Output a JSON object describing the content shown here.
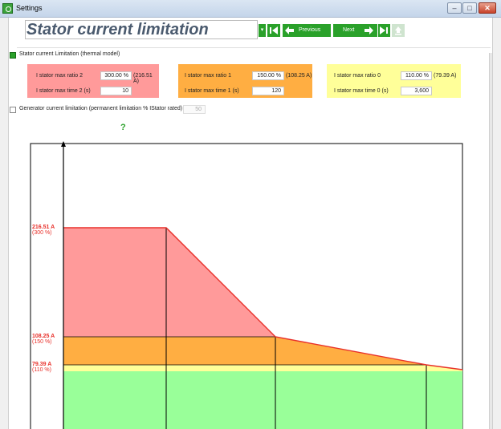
{
  "window": {
    "title": "Settings"
  },
  "header": {
    "page_title": "Stator current limitation",
    "previous_label": "Previous",
    "next_label": "Next"
  },
  "thermal": {
    "checkbox_label": "Stator current Limitation (thermal model)",
    "checked": true,
    "levels": [
      {
        "ratio_label": "I stator max ratio 2",
        "ratio_value": "300.00 %",
        "amps": "(216.51 A)",
        "time_label": "I stator max time 2 (s)",
        "time_value": "10",
        "color": "#ff9a9a"
      },
      {
        "ratio_label": "I stator max ratio 1",
        "ratio_value": "150.00 %",
        "amps": "(108.25 A)",
        "time_label": "I stator max time 1 (s)",
        "time_value": "120",
        "color": "#ffae42"
      },
      {
        "ratio_label": "I stator max ratio 0",
        "ratio_value": "110.00 %",
        "amps": "(79.39 A)",
        "time_label": "I stator max time 0 (s)",
        "time_value": "3,600",
        "color": "#ffff99"
      }
    ]
  },
  "generator": {
    "checkbox_label": "Generator current limitation (permanent limitation % IStator rated)",
    "checked": false,
    "value": "50"
  },
  "help": {
    "symbol": "?"
  },
  "chart": {
    "labels": [
      {
        "amps": "216.51 A",
        "percent": "(300 %)"
      },
      {
        "amps": "108.25 A",
        "percent": "(150 %)"
      },
      {
        "amps": "79.39 A",
        "percent": "(110 %)"
      }
    ],
    "colors": {
      "red": "#ff9a9a",
      "orange": "#ffae42",
      "yellow": "#ffff99",
      "green": "#99ff99",
      "curve": "#e8302a",
      "label": "#e8302a"
    }
  }
}
